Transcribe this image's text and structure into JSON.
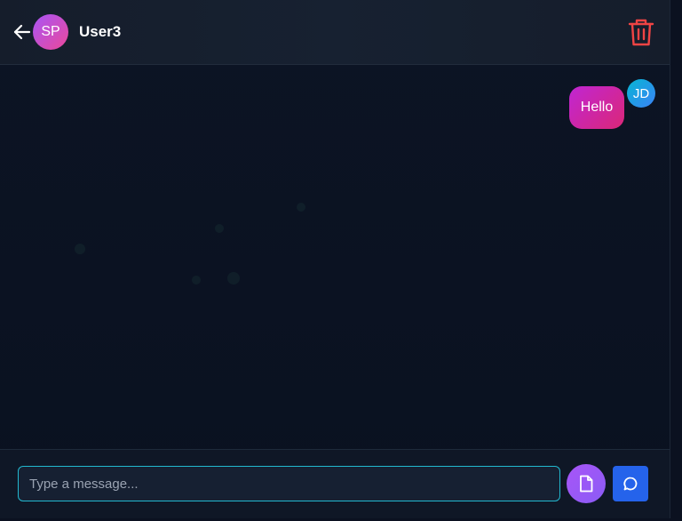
{
  "header": {
    "contact_initials": "SP",
    "contact_name": "User3"
  },
  "messages": [
    {
      "text": "Hello",
      "sender_initials": "JD"
    }
  ],
  "composer": {
    "placeholder": "Type a message..."
  },
  "icons": {
    "back": "arrow-left-icon",
    "delete": "trash-icon",
    "file": "file-icon",
    "send": "message-circle-icon"
  },
  "colors": {
    "accent_input_border": "#22b8cf",
    "delete_red": "#ef4444",
    "send_blue": "#2563eb"
  }
}
